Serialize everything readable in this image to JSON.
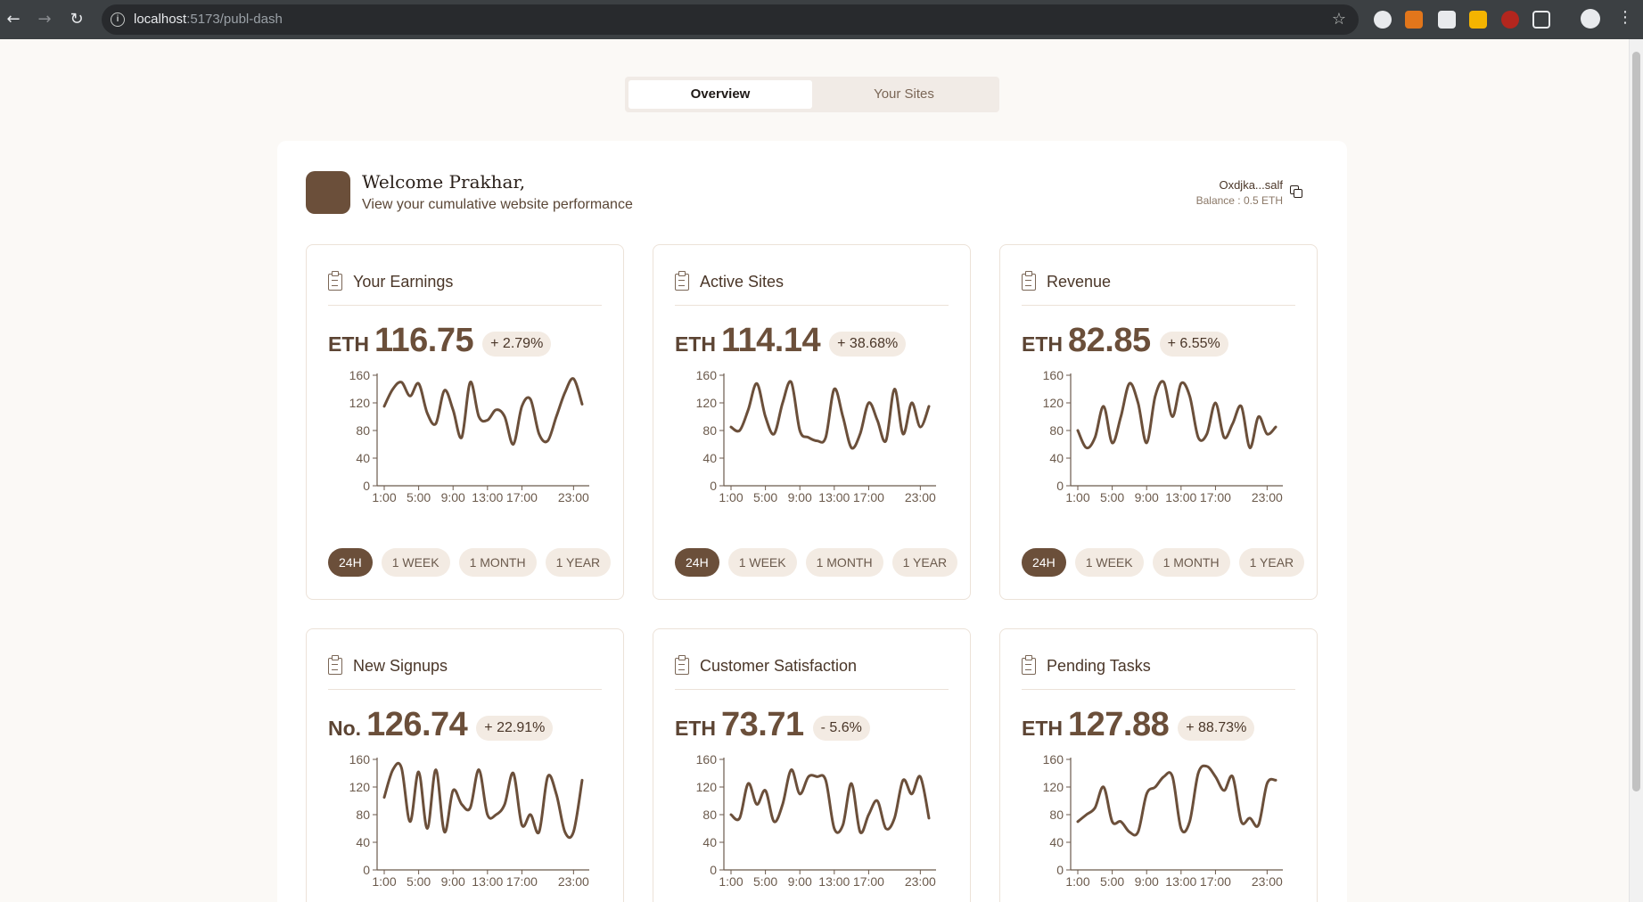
{
  "browser": {
    "url_host": "localhost",
    "url_path": ":5173/publ-dash"
  },
  "tabs": [
    {
      "label": "Overview",
      "active": true
    },
    {
      "label": "Your Sites",
      "active": false
    }
  ],
  "header": {
    "title": "Welcome Prakhar,",
    "subtitle": "View your cumulative website performance",
    "wallet_address": "Oxdjka...salf",
    "balance": "Balance : 0.5 ETH"
  },
  "colors": {
    "accent": "#6b4f3a",
    "line": "#6b4f3a",
    "chip": "#f3ebe3"
  },
  "time_ranges": [
    "24H",
    "1 WEEK",
    "1 MONTH",
    "1 YEAR"
  ],
  "cards": [
    {
      "title": "Your Earnings",
      "unit": "ETH",
      "value": "116.75",
      "change": "+ 2.79%"
    },
    {
      "title": "Active Sites",
      "unit": "ETH",
      "value": "114.14",
      "change": "+ 38.68%"
    },
    {
      "title": "Revenue",
      "unit": "ETH",
      "value": "82.85",
      "change": "+ 6.55%"
    },
    {
      "title": "New Signups",
      "unit": "No.",
      "value": "126.74",
      "change": "+ 22.91%"
    },
    {
      "title": "Customer Satisfaction",
      "unit": "ETH",
      "value": "73.71",
      "change": "- 5.6%"
    },
    {
      "title": "Pending Tasks",
      "unit": "ETH",
      "value": "127.88",
      "change": "+ 88.73%"
    }
  ],
  "chart_data": [
    {
      "type": "line",
      "x_ticks": [
        "1:00",
        "5:00",
        "9:00",
        "13:00",
        "17:00",
        "23:00"
      ],
      "ylim": [
        0,
        160
      ],
      "y_ticks": [
        0,
        40,
        80,
        120,
        160
      ],
      "values": [
        115,
        140,
        150,
        130,
        148,
        105,
        90,
        138,
        110,
        70,
        150,
        100,
        95,
        110,
        100,
        60,
        115,
        125,
        75,
        65,
        100,
        135,
        155,
        118
      ]
    },
    {
      "type": "line",
      "x_ticks": [
        "1:00",
        "5:00",
        "9:00",
        "13:00",
        "17:00",
        "23:00"
      ],
      "ylim": [
        0,
        160
      ],
      "y_ticks": [
        0,
        40,
        80,
        120,
        160
      ],
      "values": [
        85,
        80,
        110,
        148,
        100,
        75,
        120,
        150,
        80,
        70,
        65,
        70,
        140,
        100,
        55,
        75,
        120,
        95,
        65,
        140,
        75,
        120,
        85,
        115
      ]
    },
    {
      "type": "line",
      "x_ticks": [
        "1:00",
        "5:00",
        "9:00",
        "13:00",
        "17:00",
        "23:00"
      ],
      "ylim": [
        0,
        160
      ],
      "y_ticks": [
        0,
        40,
        80,
        120,
        160
      ],
      "values": [
        80,
        55,
        70,
        115,
        62,
        100,
        148,
        120,
        62,
        130,
        150,
        100,
        148,
        130,
        70,
        75,
        120,
        70,
        90,
        115,
        55,
        100,
        75,
        85
      ]
    },
    {
      "type": "line",
      "x_ticks": [
        "1:00",
        "5:00",
        "9:00",
        "13:00",
        "17:00",
        "23:00"
      ],
      "ylim": [
        0,
        160
      ],
      "y_ticks": [
        0,
        40,
        80,
        120,
        160
      ],
      "values": [
        105,
        145,
        148,
        70,
        142,
        60,
        145,
        55,
        115,
        95,
        90,
        145,
        80,
        80,
        95,
        140,
        65,
        80,
        55,
        135,
        110,
        55,
        55,
        130
      ]
    },
    {
      "type": "line",
      "x_ticks": [
        "1:00",
        "5:00",
        "9:00",
        "13:00",
        "17:00",
        "23:00"
      ],
      "ylim": [
        0,
        160
      ],
      "y_ticks": [
        0,
        40,
        80,
        120,
        160
      ],
      "values": [
        80,
        75,
        125,
        95,
        115,
        70,
        95,
        145,
        110,
        135,
        135,
        130,
        60,
        65,
        125,
        55,
        80,
        100,
        60,
        75,
        130,
        110,
        135,
        75
      ]
    },
    {
      "type": "line",
      "x_ticks": [
        "1:00",
        "5:00",
        "9:00",
        "13:00",
        "17:00",
        "23:00"
      ],
      "ylim": [
        0,
        160
      ],
      "y_ticks": [
        0,
        40,
        80,
        120,
        160
      ],
      "values": [
        70,
        80,
        90,
        120,
        70,
        70,
        55,
        55,
        110,
        120,
        135,
        135,
        60,
        70,
        140,
        150,
        135,
        115,
        135,
        70,
        75,
        65,
        125,
        130
      ]
    }
  ]
}
